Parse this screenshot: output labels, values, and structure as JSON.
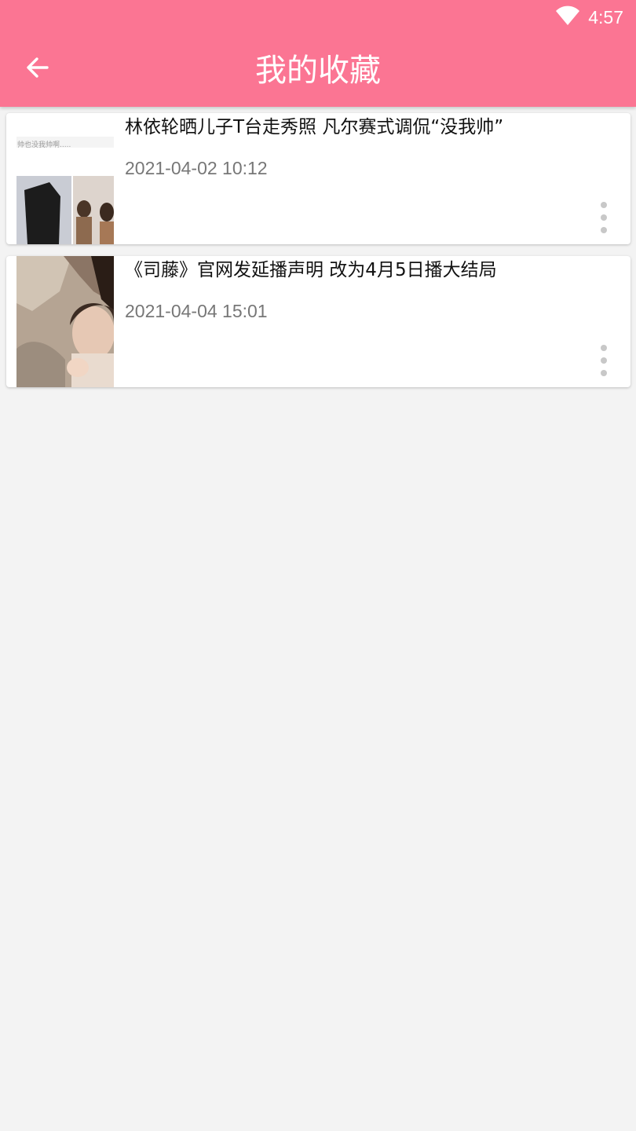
{
  "status_bar": {
    "time": "4:57",
    "wifi_icon": "wifi-icon"
  },
  "header": {
    "title": "我的收藏",
    "back_icon": "arrow-left-icon",
    "background": "#fb7593"
  },
  "favorites": [
    {
      "title": "林依轮晒儿子T台走秀照 凡尔赛式调侃“没我帅”",
      "time": "2021-04-02 10:12",
      "thumb_caption": "帅也没我帅啊.....",
      "more_icon": "more-vertical-icon"
    },
    {
      "title": "《司藤》官网发延播声明 改为4月5日播大结局",
      "time": "2021-04-04 15:01",
      "more_icon": "more-vertical-icon"
    }
  ]
}
